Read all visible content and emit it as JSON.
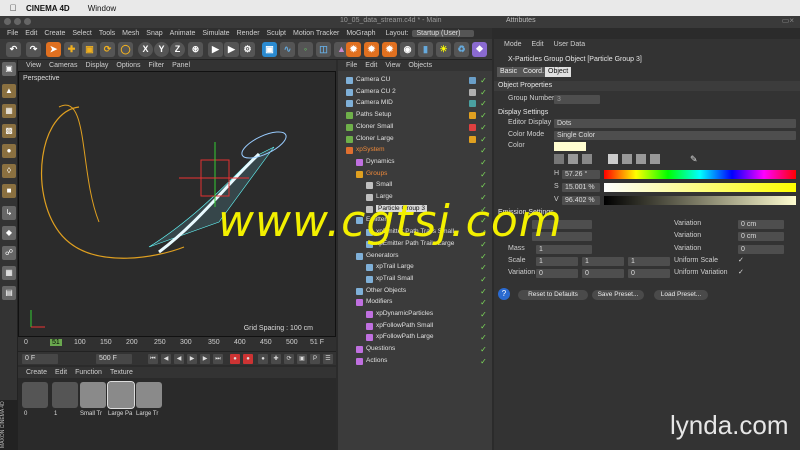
{
  "macbar": {
    "app": "CINEMA 4D",
    "menu": [
      "Window"
    ]
  },
  "window": {
    "title": "10_05_data_stream.c4d * - Main",
    "attributes_title": "Attributes"
  },
  "app_menu": {
    "items": [
      "File",
      "Edit",
      "Create",
      "Select",
      "Tools",
      "Mesh",
      "Snap",
      "Animate",
      "Simulate",
      "Render",
      "Sculpt",
      "Motion Tracker",
      "MoGraph"
    ],
    "layout_label": "Layout:",
    "layout_value": "Startup (User)"
  },
  "toolbar": {
    "axis_x": "X",
    "axis_y": "Y",
    "axis_z": "Z"
  },
  "viewport": {
    "menu": [
      "View",
      "Cameras",
      "Display",
      "Options",
      "Filter",
      "Panel"
    ],
    "label": "Perspective",
    "grid_spacing": "Grid Spacing : 100 cm"
  },
  "timeline": {
    "ticks": [
      "0",
      "50",
      "100",
      "150",
      "200",
      "250",
      "300",
      "350",
      "400",
      "450",
      "500"
    ],
    "current": "51",
    "frame_label": "51 F",
    "start": "0 F",
    "end": "500 F"
  },
  "material_manager": {
    "menu": [
      "Create",
      "Edit",
      "Function",
      "Texture"
    ],
    "materials": [
      "0",
      "1",
      "Small Tr",
      "Large Pa",
      "Large Tr"
    ],
    "maxon": "MAXON CINEMA 4D"
  },
  "object_manager": {
    "menu": [
      "File",
      "Edit",
      "View",
      "Objects"
    ],
    "rows": [
      {
        "name": "Camera CU",
        "indent": 0,
        "icon": "#7fb0d8",
        "tag": "#6a9fc8"
      },
      {
        "name": "Camera CU 2",
        "indent": 0,
        "icon": "#7fb0d8",
        "tag": "#b0b0b0"
      },
      {
        "name": "Camera MID",
        "indent": 0,
        "icon": "#7fb0d8",
        "tag": "#4aa0a0"
      },
      {
        "name": "Paths Setup",
        "indent": 0,
        "icon": "#6fb04a",
        "tag": "#e0a020"
      },
      {
        "name": "Cloner Small",
        "indent": 0,
        "icon": "#6fb04a",
        "tag": "#e04040"
      },
      {
        "name": "Cloner Large",
        "indent": 0,
        "icon": "#6fb04a",
        "tag": "#e0a020"
      },
      {
        "name": "xpSystem",
        "indent": 0,
        "icon": "#e07030",
        "tag": ""
      },
      {
        "name": "Dynamics",
        "indent": 1,
        "icon": "#c070e0",
        "tag": ""
      },
      {
        "name": "Groups",
        "indent": 1,
        "icon": "#e0a020",
        "tag": ""
      },
      {
        "name": "Small",
        "indent": 2,
        "icon": "#c0c0c0",
        "tag": ""
      },
      {
        "name": "Large",
        "indent": 2,
        "icon": "#c0c0c0",
        "tag": ""
      },
      {
        "name": "Particle Group 3",
        "indent": 2,
        "icon": "#c0c0c0",
        "tag": ""
      },
      {
        "name": "Emitters",
        "indent": 1,
        "icon": "#7fb0d8",
        "tag": ""
      },
      {
        "name": "xpEmitter Path Trails Small",
        "indent": 2,
        "icon": "#7fb0d8",
        "tag": ""
      },
      {
        "name": "xpEmitter Path Trails Large",
        "indent": 2,
        "icon": "#7fb0d8",
        "tag": ""
      },
      {
        "name": "Generators",
        "indent": 1,
        "icon": "#7fb0d8",
        "tag": ""
      },
      {
        "name": "xpTrail Large",
        "indent": 2,
        "icon": "#7fb0d8",
        "tag": ""
      },
      {
        "name": "xpTrail Small",
        "indent": 2,
        "icon": "#7fb0d8",
        "tag": ""
      },
      {
        "name": "Other Objects",
        "indent": 1,
        "icon": "#7fb0d8",
        "tag": ""
      },
      {
        "name": "Modifiers",
        "indent": 1,
        "icon": "#c070e0",
        "tag": ""
      },
      {
        "name": "xpDynamicParticles",
        "indent": 2,
        "icon": "#c070e0",
        "tag": ""
      },
      {
        "name": "xpFollowPath Small",
        "indent": 2,
        "icon": "#c070e0",
        "tag": ""
      },
      {
        "name": "xpFollowPath Large",
        "indent": 2,
        "icon": "#c070e0",
        "tag": ""
      },
      {
        "name": "Questions",
        "indent": 1,
        "icon": "#c070e0",
        "tag": ""
      },
      {
        "name": "Actions",
        "indent": 1,
        "icon": "#c070e0",
        "tag": ""
      }
    ]
  },
  "attributes": {
    "menu": [
      "Mode",
      "Edit",
      "User Data"
    ],
    "object_title": "X-Particles Group Object [Particle Group 3]",
    "tabs": [
      "Basic",
      "Coord.",
      "Object"
    ],
    "object_properties": "Object Properties",
    "group_number_label": "Group Number",
    "group_number": "3",
    "display_settings": "Display Settings",
    "editor_display_label": "Editor Display",
    "editor_display": "Dots",
    "color_mode_label": "Color Mode",
    "color_mode": "Single Color",
    "color_label": "Color",
    "color_swatch": "#fffdd0",
    "h_label": "H",
    "h_value": "57.26 °",
    "s_label": "S",
    "s_value": "15.001 %",
    "v_label": "V",
    "v_value": "96.402 %",
    "emission_settings": "Emission Settings",
    "mass_label": "Mass",
    "mass_value": "1",
    "scale_label": "Scale",
    "scale_values": [
      "1",
      "1",
      "1"
    ],
    "variation_label": "Variation",
    "variation_values": [
      "0",
      "0",
      "0"
    ],
    "var_right": [
      {
        "label": "Variation",
        "value": "0 cm"
      },
      {
        "label": "Variation",
        "value": "0 cm"
      },
      {
        "label": "Variation",
        "value": "0"
      }
    ],
    "uniform_scale": "Uniform Scale",
    "uniform_variation": "Uniform Variation",
    "buttons": [
      "Reset to Defaults",
      "Save Preset...",
      "Load Preset..."
    ]
  },
  "watermark": "www.cgtsj.com",
  "brand": "lynda.com"
}
